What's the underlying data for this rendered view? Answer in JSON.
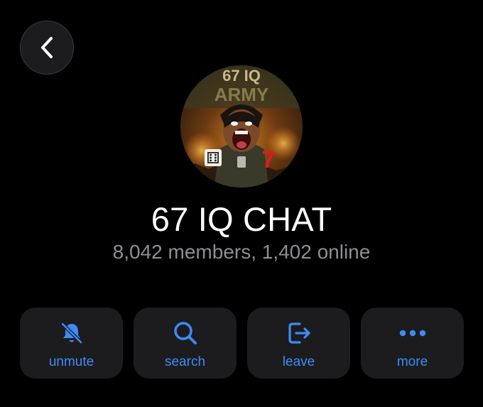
{
  "header": {
    "back_icon": "chevron-left-icon"
  },
  "chat": {
    "avatar_text_line1": "67 IQ",
    "avatar_text_line2": "ARMY",
    "avatar_dice_glyph": "⚅",
    "avatar_seven": "7",
    "title": "67 IQ CHAT",
    "subtitle": "8,042 members, 1,402 online"
  },
  "actions": [
    {
      "label": "unmute",
      "icon": "bell-slash-icon"
    },
    {
      "label": "search",
      "icon": "search-icon"
    },
    {
      "label": "leave",
      "icon": "leave-icon"
    },
    {
      "label": "more",
      "icon": "ellipsis-icon"
    }
  ],
  "colors": {
    "background": "#000000",
    "card": "#1c1c1e",
    "accent": "#3e8bf7",
    "title": "#ffffff",
    "subtitle": "#8e8e93"
  }
}
